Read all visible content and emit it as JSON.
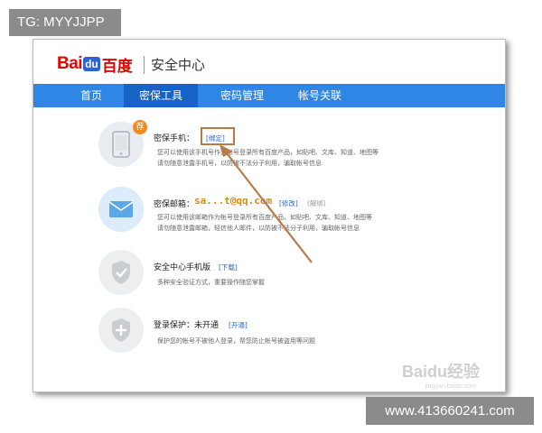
{
  "overlay_tag": "TG: MYYJJPP",
  "overlay_url": "www.413660241.com",
  "header": {
    "logo_bai": "Bai",
    "logo_du": "du",
    "logo_cn": "百度",
    "site_title": "安全中心"
  },
  "nav": {
    "items": [
      {
        "label": "首页"
      },
      {
        "label": "密保工具"
      },
      {
        "label": "密码管理"
      },
      {
        "label": "帐号关联"
      }
    ],
    "active_index": 1
  },
  "features": {
    "phone": {
      "badge": "荐",
      "title": "密保手机：",
      "action": "[绑定]",
      "desc1": "您可以使用该手机号作为帐号登录所有百度产品，如贴吧、文库、知道、地图等",
      "desc2": "请勿随意泄露手机号，以防被不法分子利用，骗取帐号信息"
    },
    "email": {
      "title": "密保邮箱：",
      "value": "sa...t@qq.com",
      "action": "[修改]",
      "status": "(解绑)",
      "desc1": "您可以使用该邮箱作为帐号登录所有百度产品，如贴吧、文库、知道、地图等",
      "desc2": "请勿随意泄露邮箱，轻信他人邮件，以防被不法分子利用，骗取帐号信息"
    },
    "mobile_app": {
      "title": "安全中心手机版",
      "action": "[下载]",
      "desc1": "多种安全验证方式，重要操作随您掌握"
    },
    "login_protect": {
      "title": "登录保护：未开通",
      "action": "[开通]",
      "desc1": "保护您的帐号不被他人登录，帮您防止帐号被盗用等问题"
    }
  },
  "watermark": {
    "text": "Baidu经验",
    "sub": "jingyan.baidu.com"
  },
  "colors": {
    "nav_bg": "#2f86e4",
    "nav_active": "#1663c8",
    "link": "#3168c8",
    "accent_orange": "#f08a1c",
    "email_value": "#d98b17",
    "highlight": "#b77a48"
  }
}
